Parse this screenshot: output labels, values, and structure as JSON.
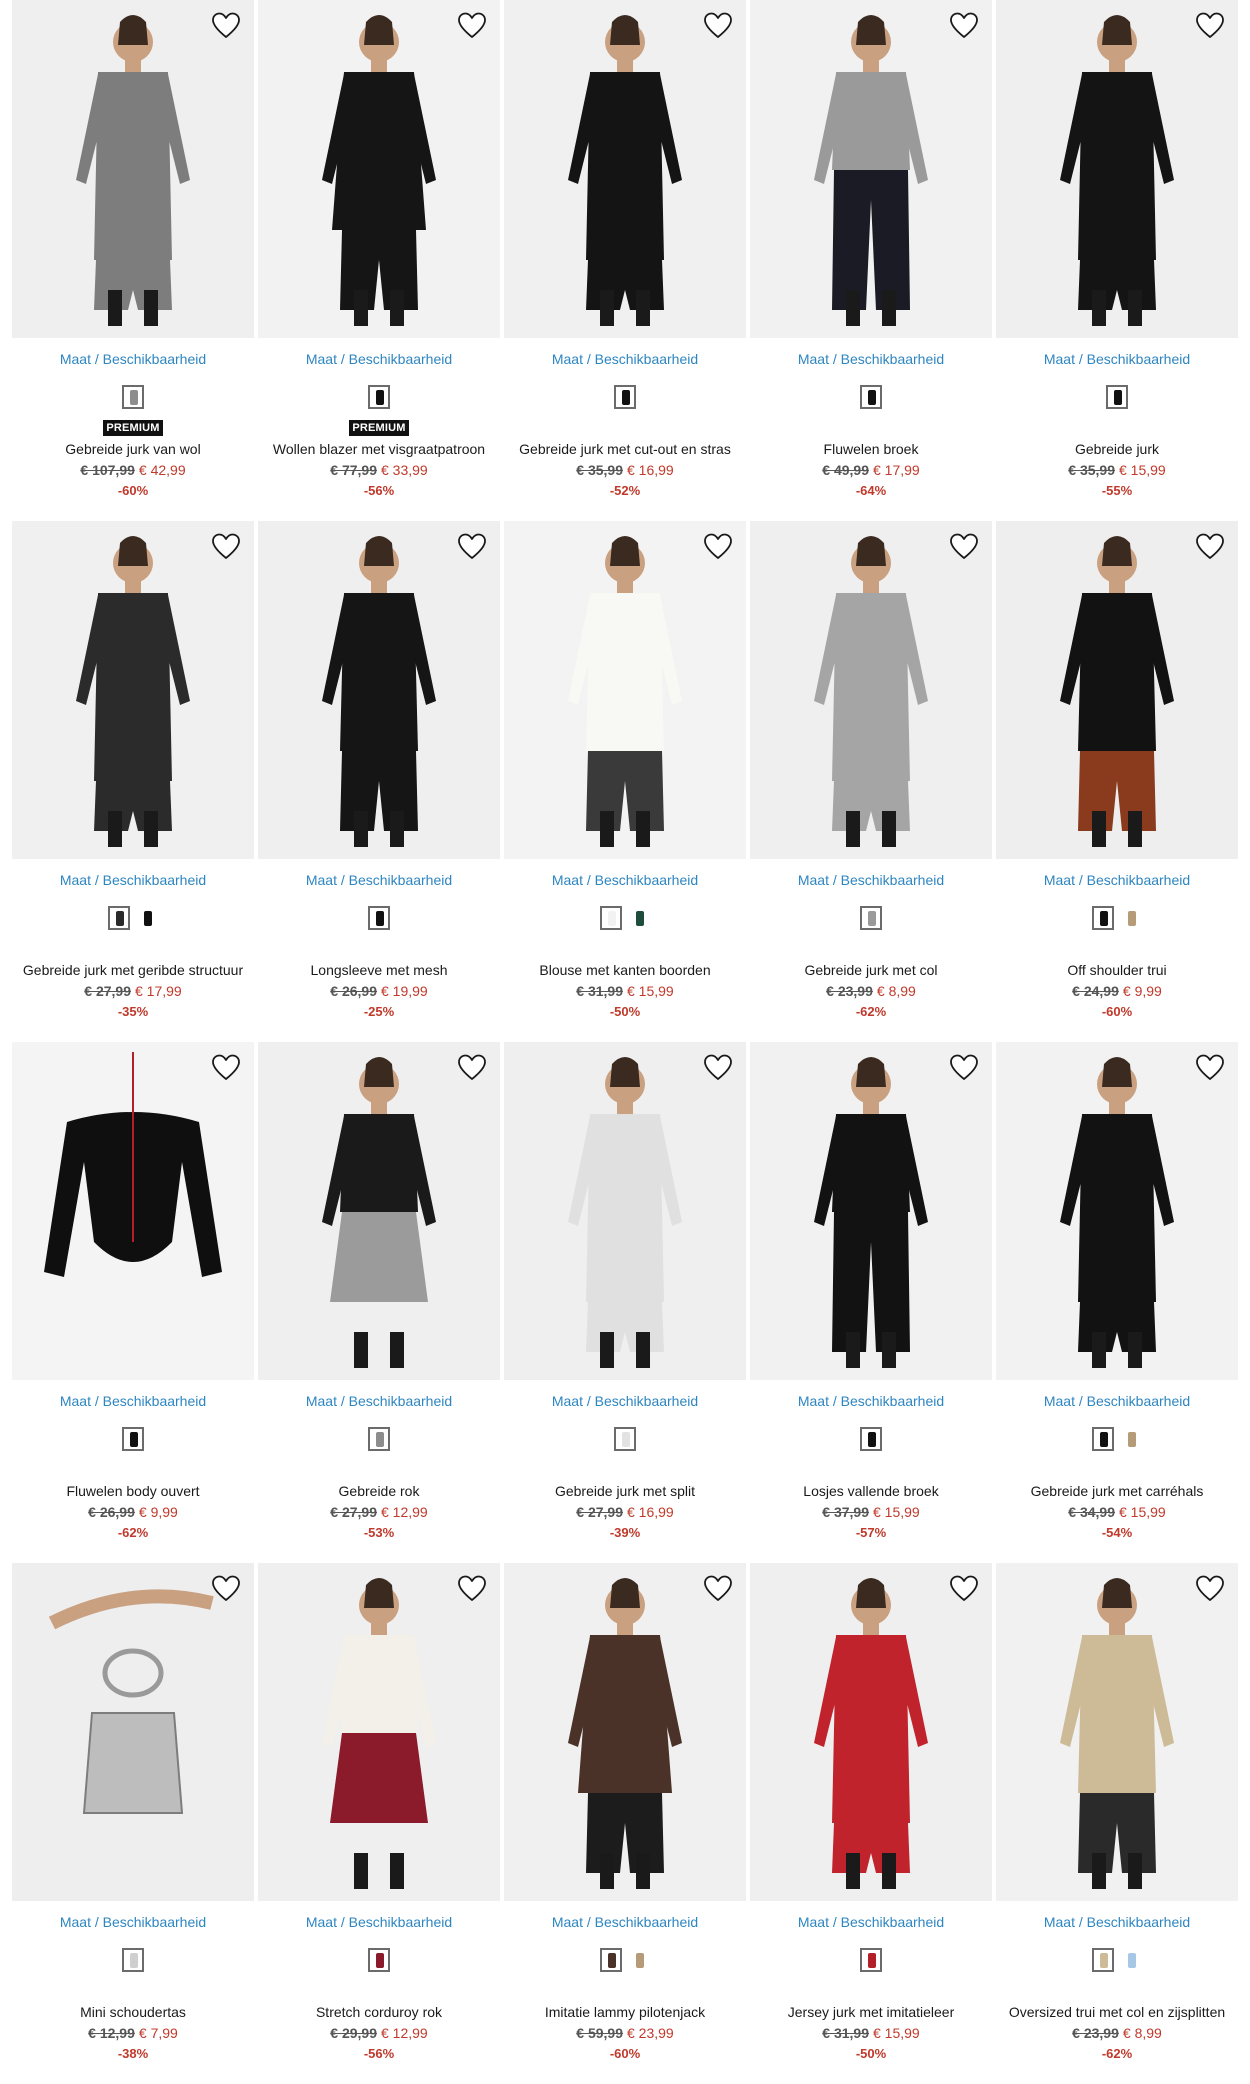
{
  "common": {
    "size_link": "Maat / Beschikbaarheid"
  },
  "products": [
    {
      "name": "Gebreide jurk van wol",
      "old_price": "€ 107,99",
      "new_price": "€ 42,99",
      "discount": "-60%",
      "badge": "PREMIUM",
      "swatches": [
        "#8d8d8d"
      ],
      "colors": {
        "bg": "#efefef",
        "top": "#7d7d7d",
        "bottom": "#7d7d7d"
      },
      "kind": "dress"
    },
    {
      "name": "Wollen blazer met visgraatpatroon",
      "old_price": "€ 77,99",
      "new_price": "€ 33,99",
      "discount": "-56%",
      "badge": "PREMIUM",
      "swatches": [
        "#111111"
      ],
      "colors": {
        "bg": "#f2f2f2",
        "top": "#151515",
        "bottom": "#151515"
      },
      "kind": "blazer"
    },
    {
      "name": "Gebreide jurk met cut-out en stras",
      "old_price": "€ 35,99",
      "new_price": "€ 16,99",
      "discount": "-52%",
      "badge": "",
      "swatches": [
        "#111111"
      ],
      "colors": {
        "bg": "#f0f0f0",
        "top": "#141414",
        "bottom": "#141414"
      },
      "kind": "dress"
    },
    {
      "name": "Fluwelen broek",
      "old_price": "€ 49,99",
      "new_price": "€ 17,99",
      "discount": "-64%",
      "badge": "",
      "swatches": [
        "#111111"
      ],
      "colors": {
        "bg": "#f1f1f1",
        "top": "#9a9a9a",
        "bottom": "#1b1b25"
      },
      "kind": "pants"
    },
    {
      "name": "Gebreide jurk",
      "old_price": "€ 35,99",
      "new_price": "€ 15,99",
      "discount": "-55%",
      "badge": "",
      "swatches": [
        "#111111"
      ],
      "colors": {
        "bg": "#efefef",
        "top": "#141414",
        "bottom": "#141414"
      },
      "kind": "dress"
    },
    {
      "name": "Gebreide jurk met geribde structuur",
      "old_price": "€ 27,99",
      "new_price": "€ 17,99",
      "discount": "-35%",
      "badge": "",
      "swatches": [
        "#2a2a2a",
        "#111111"
      ],
      "colors": {
        "bg": "#f0f0f0",
        "top": "#2b2b2b",
        "bottom": "#2b2b2b"
      },
      "kind": "dress"
    },
    {
      "name": "Longsleeve met mesh",
      "old_price": "€ 26,99",
      "new_price": "€ 19,99",
      "discount": "-25%",
      "badge": "",
      "swatches": [
        "#111111"
      ],
      "colors": {
        "bg": "#efefef",
        "top": "#151515",
        "bottom": "#151515"
      },
      "kind": "top"
    },
    {
      "name": "Blouse met kanten boorden",
      "old_price": "€ 31,99",
      "new_price": "€ 15,99",
      "discount": "-50%",
      "badge": "",
      "swatches": [
        "#f2f2f2",
        "#1f4d3d"
      ],
      "colors": {
        "bg": "#f3f3f3",
        "top": "#f8f8f4",
        "bottom": "#3a3a3a"
      },
      "kind": "top"
    },
    {
      "name": "Gebreide jurk met col",
      "old_price": "€ 23,99",
      "new_price": "€ 8,99",
      "discount": "-62%",
      "badge": "",
      "swatches": [
        "#9a9a9a"
      ],
      "colors": {
        "bg": "#efefef",
        "top": "#a5a5a5",
        "bottom": "#a5a5a5"
      },
      "kind": "dress"
    },
    {
      "name": "Off shoulder trui",
      "old_price": "€ 24,99",
      "new_price": "€ 9,99",
      "discount": "-60%",
      "badge": "",
      "swatches": [
        "#111111",
        "#b59b78"
      ],
      "colors": {
        "bg": "#eeeeee",
        "top": "#121212",
        "bottom": "#8a3b1e"
      },
      "kind": "top"
    },
    {
      "name": "Fluwelen body ouvert",
      "old_price": "€ 26,99",
      "new_price": "€ 9,99",
      "discount": "-62%",
      "badge": "",
      "swatches": [
        "#111111"
      ],
      "colors": {
        "bg": "#f4f4f4",
        "top": "#0f0f0f",
        "bottom": "#0f0f0f"
      },
      "kind": "body"
    },
    {
      "name": "Gebreide rok",
      "old_price": "€ 27,99",
      "new_price": "€ 12,99",
      "discount": "-53%",
      "badge": "",
      "swatches": [
        "#8d8d8d"
      ],
      "colors": {
        "bg": "#efefef",
        "top": "#1a1a1a",
        "bottom": "#9b9b9b"
      },
      "kind": "skirt"
    },
    {
      "name": "Gebreide jurk met split",
      "old_price": "€ 27,99",
      "new_price": "€ 16,99",
      "discount": "-39%",
      "badge": "",
      "swatches": [
        "#e2e2e2"
      ],
      "colors": {
        "bg": "#efefef",
        "top": "#e0e0e0",
        "bottom": "#e0e0e0"
      },
      "kind": "dress"
    },
    {
      "name": "Losjes vallende broek",
      "old_price": "€ 37,99",
      "new_price": "€ 15,99",
      "discount": "-57%",
      "badge": "",
      "swatches": [
        "#111111"
      ],
      "colors": {
        "bg": "#f1f1f1",
        "top": "#121212",
        "bottom": "#121212"
      },
      "kind": "pants"
    },
    {
      "name": "Gebreide jurk met carréhals",
      "old_price": "€ 34,99",
      "new_price": "€ 15,99",
      "discount": "-54%",
      "badge": "",
      "swatches": [
        "#111111",
        "#b59b78"
      ],
      "colors": {
        "bg": "#f2f2f2",
        "top": "#121212",
        "bottom": "#121212"
      },
      "kind": "dress"
    },
    {
      "name": "Mini schoudertas",
      "old_price": "€ 12,99",
      "new_price": "€ 7,99",
      "discount": "-38%",
      "badge": "",
      "swatches": [
        "#cfcfcf"
      ],
      "colors": {
        "bg": "#eeeeee",
        "top": "#bdbdbd",
        "bottom": "#bdbdbd"
      },
      "kind": "bag"
    },
    {
      "name": "Stretch corduroy rok",
      "old_price": "€ 29,99",
      "new_price": "€ 12,99",
      "discount": "-56%",
      "badge": "",
      "swatches": [
        "#8b1a2b"
      ],
      "colors": {
        "bg": "#efefef",
        "top": "#f3f0ea",
        "bottom": "#8b1a2b"
      },
      "kind": "skirt"
    },
    {
      "name": "Imitatie lammy pilotenjack",
      "old_price": "€ 59,99",
      "new_price": "€ 23,99",
      "discount": "-60%",
      "badge": "",
      "swatches": [
        "#4a3228",
        "#b59b78"
      ],
      "colors": {
        "bg": "#f0f0f0",
        "top": "#4a3228",
        "bottom": "#1c1c1c"
      },
      "kind": "blazer"
    },
    {
      "name": "Jersey jurk met imitatieleer",
      "old_price": "€ 31,99",
      "new_price": "€ 15,99",
      "discount": "-50%",
      "badge": "",
      "swatches": [
        "#b3202a"
      ],
      "colors": {
        "bg": "#efefef",
        "top": "#c0232c",
        "bottom": "#c0232c"
      },
      "kind": "dress"
    },
    {
      "name": "Oversized trui met col en zijsplitten",
      "old_price": "€ 23,99",
      "new_price": "€ 8,99",
      "discount": "-62%",
      "badge": "",
      "swatches": [
        "#cdbb98",
        "#a7c7e7"
      ],
      "colors": {
        "bg": "#f1f1f1",
        "top": "#cdbb98",
        "bottom": "#2a2a2a"
      },
      "kind": "top"
    }
  ]
}
